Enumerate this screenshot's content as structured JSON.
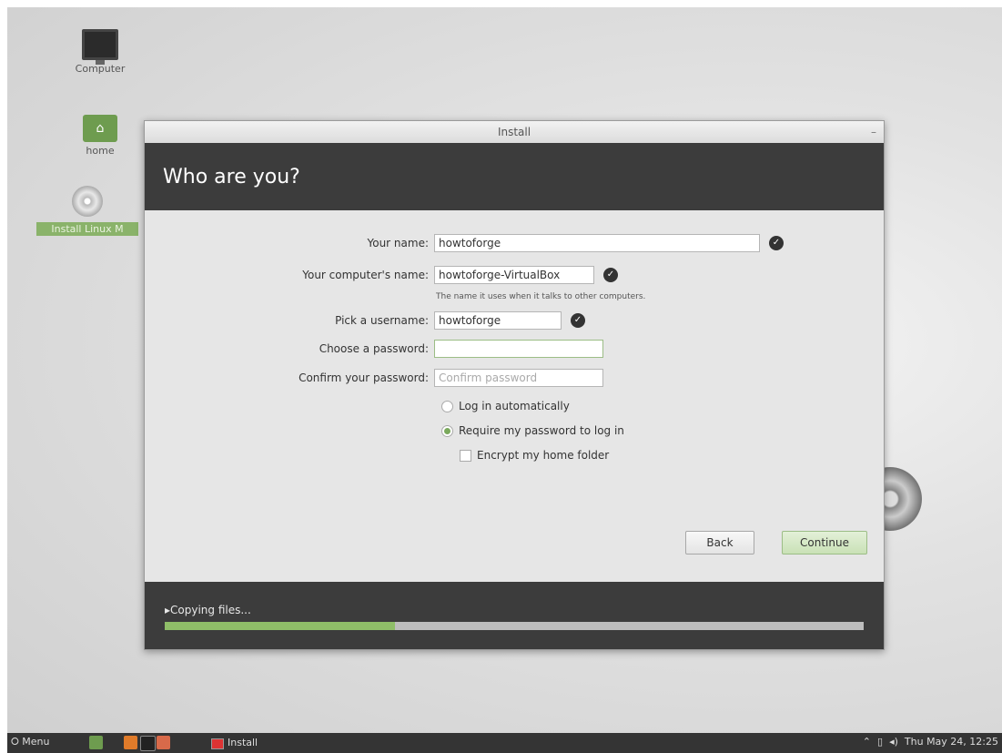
{
  "desktop": {
    "icons": [
      {
        "label": "Computer"
      },
      {
        "label": "home"
      },
      {
        "label": "Install Linux M"
      }
    ]
  },
  "window": {
    "title": "Install",
    "minimize": "–",
    "heading": "Who are you?"
  },
  "form": {
    "your_name": {
      "label": "Your name:",
      "value": "howtoforge"
    },
    "computer_name": {
      "label": "Your computer's name:",
      "value": "howtoforge-VirtualBox",
      "hint": "The name it uses when it talks to other computers."
    },
    "username": {
      "label": "Pick a username:",
      "value": "howtoforge"
    },
    "password": {
      "label": "Choose a password:",
      "value": ""
    },
    "confirm_password": {
      "label": "Confirm your password:",
      "placeholder": "Confirm password"
    },
    "login_auto": {
      "label": "Log in automatically",
      "selected": false
    },
    "login_require": {
      "label": "Require my password to log in",
      "selected": true
    },
    "encrypt_home": {
      "label": "Encrypt my home folder",
      "checked": false
    }
  },
  "buttons": {
    "back": "Back",
    "continue": "Continue"
  },
  "progress": {
    "label": "▸Copying files...",
    "fraction": 0.33
  },
  "taskbar": {
    "menu_label": "Menu",
    "task_label": "Install",
    "clock": "Thu May 24, 12:25"
  },
  "icons": {
    "checkmark": "check-circle-icon",
    "computer": "monitor-icon",
    "home": "home-folder-icon",
    "install": "disc-icon"
  },
  "colors": {
    "accent": "#8fbe68",
    "header": "#3c3c3c"
  }
}
